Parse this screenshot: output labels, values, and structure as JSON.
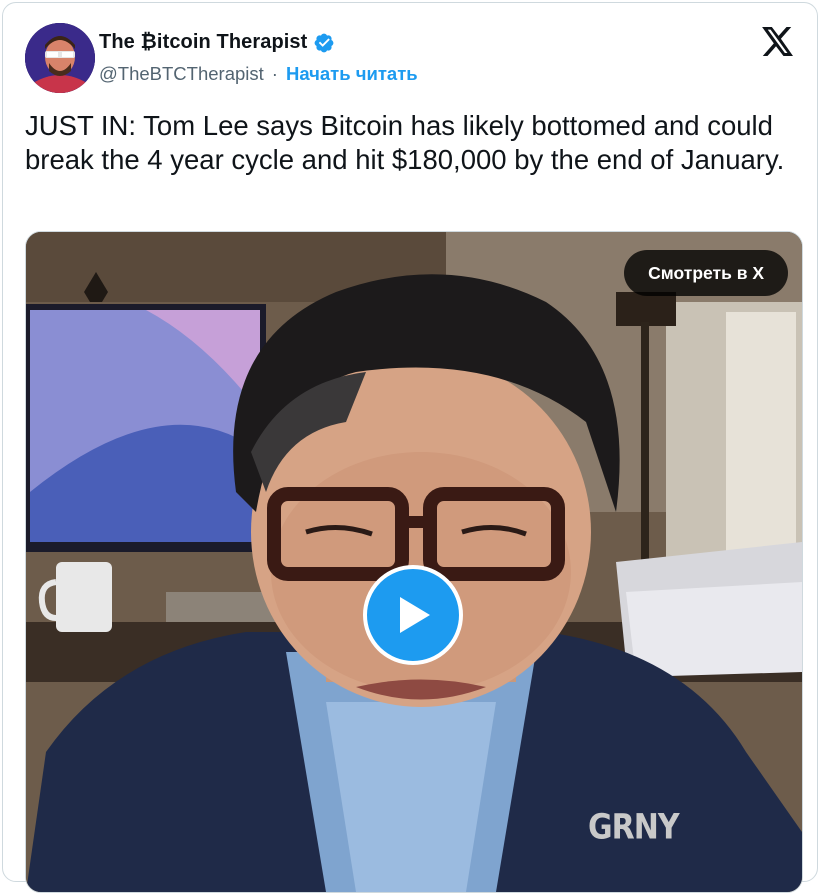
{
  "author": {
    "display_name": "The ₿itcoin Therapist",
    "handle": "@TheBTCTherapist",
    "separator": "·",
    "follow_label": "Начать читать",
    "verified": true
  },
  "tweet": {
    "text": "JUST IN: Tom Lee says Bitcoin has likely bottomed and could break the 4 year cycle and hit $180,000 by the end of January."
  },
  "media": {
    "watch_label": "Смотреть в X",
    "watermark": "GRNY"
  },
  "colors": {
    "accent": "#1d9bf0",
    "text": "#0f1419",
    "secondary": "#536471"
  },
  "icons": [
    "x-logo-icon",
    "verified-badge-icon",
    "play-icon"
  ]
}
